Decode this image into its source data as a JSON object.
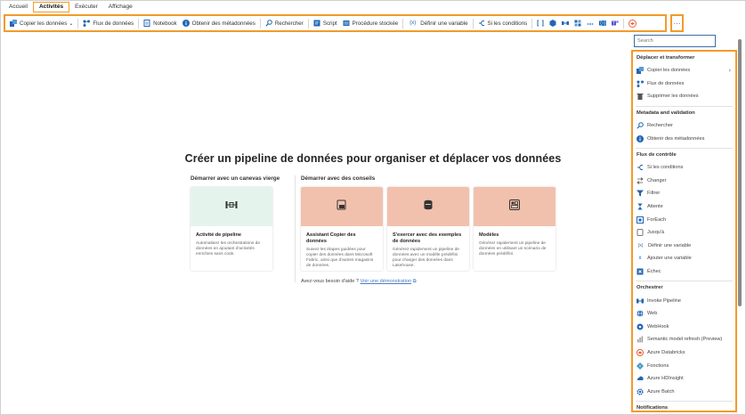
{
  "colors": {
    "highlight": "#f29b2a",
    "accent_blue": "#2266b3",
    "card_green": "#e4f4ec",
    "card_peach": "#f2c1ad"
  },
  "menu": {
    "tabs": [
      "Accueil",
      "Activités",
      "Exécuter",
      "Affichage"
    ],
    "active": "Activités"
  },
  "toolbar": {
    "copy": "Copier les données",
    "dataflow": "Flux de données",
    "notebook": "Notebook",
    "metadata": "Obtenir des métadonnées",
    "lookup": "Rechercher",
    "script": "Script",
    "proc": "Procédure stockée",
    "setvar": "Définir une variable",
    "ifcond": "Si les conditions",
    "more": "···"
  },
  "main": {
    "title": "Créer un pipeline de données pour organiser et déplacer vos données",
    "blank_label": "Démarrer avec un canevas vierge",
    "guided_label": "Démarrer avec des conseils",
    "cards": [
      {
        "title": "Activité de pipeline",
        "desc": "Automatisez les orchestrations de données en ajoutant d'activités enrichies sans code."
      },
      {
        "title": "Assistant Copier des données",
        "desc": "Suivez les étapes guidées pour copier des données dans Microsoft Fabric, ainsi que d'autres magasins de données."
      },
      {
        "title": "S'exercer avec des exemples de données",
        "desc": "Générez rapidement un pipeline de données avec un modèle prédéfini pour charger des données dans Lakehouse."
      },
      {
        "title": "Modèles",
        "desc": "Générez rapidement un pipeline de données en utilisant un scénario de données prédéfini."
      }
    ],
    "help_text": "Avez-vous besoin d'aide ?",
    "help_link": "Voir une démonstration"
  },
  "panel": {
    "search_placeholder": "Search",
    "s1": "Déplacer et transformer",
    "s1_items": [
      "Copier les données",
      "Flux de données",
      "Supprimer les données"
    ],
    "s2": "Metadata and validation",
    "s2_items": [
      "Rechercher",
      "Obtenir des métadonnées"
    ],
    "s3": "Flux de contrôle",
    "s3_items": [
      "Si les conditions",
      "Changer",
      "Filtrer",
      "Attente",
      "ForEach",
      "Jusqu'à",
      "Définir une variable",
      "Ajouter une variable",
      "Échec"
    ],
    "s4": "Orchestrer",
    "s4_items": [
      "Invoke Pipeline",
      "Web",
      "WebHook",
      "Semantic model refresh (Preview)",
      "Azure Databricks",
      "Fonctions",
      "Azure HDInsight",
      "Azure Batch"
    ],
    "s5": "Notifications"
  }
}
